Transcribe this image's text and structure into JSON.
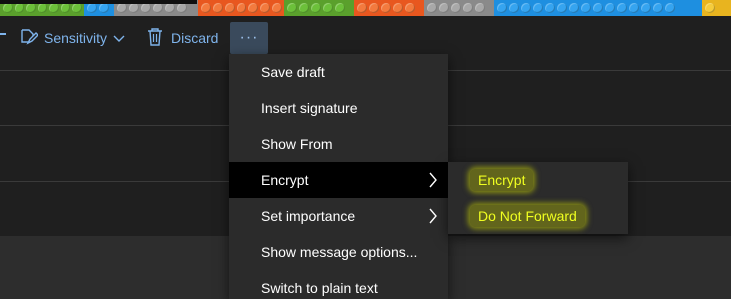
{
  "toolbar": {
    "sensitivity_label": "Sensitivity",
    "discard_label": "Discard",
    "more_label": "···",
    "sensitivity_icon": "sensitivity-icon",
    "discard_icon": "trash-icon"
  },
  "menu": {
    "items": [
      {
        "label": "Save draft"
      },
      {
        "label": "Insert signature"
      },
      {
        "label": "Show From"
      },
      {
        "label": "Encrypt",
        "has_submenu": true,
        "active": true
      },
      {
        "label": "Set importance",
        "has_submenu": true
      },
      {
        "label": "Show message options..."
      },
      {
        "label": "Switch to plain text"
      }
    ]
  },
  "submenu": {
    "items": [
      {
        "label": "Encrypt"
      },
      {
        "label": "Do Not Forward"
      }
    ]
  },
  "colors": {
    "accent": "#7fb4ec",
    "background": "#1f1f1f",
    "menu_bg": "#2b2b2b",
    "highlight": "#d8e300"
  }
}
